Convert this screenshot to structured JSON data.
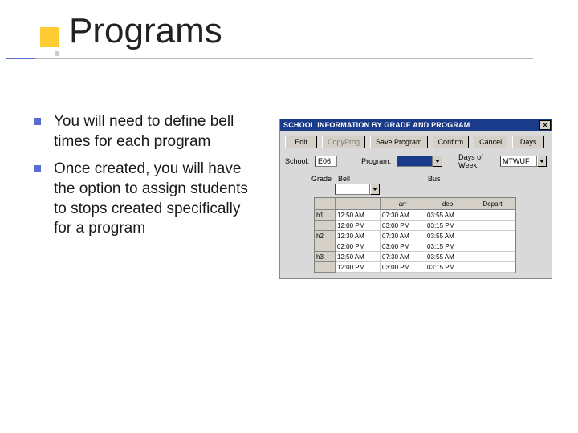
{
  "slide": {
    "title": "Programs",
    "bullets": [
      "You will need to define bell times for each program",
      "Once created, you will have the option to assign students to stops created specifically for a program"
    ]
  },
  "appwin": {
    "title": "SCHOOL INFORMATION BY GRADE AND PROGRAM",
    "close_label": "×",
    "buttons": {
      "edit": "Edit",
      "copyprog": "CopyProg",
      "saveprogram": "Save Program",
      "confirm": "Confirm",
      "cancel": "Cancel",
      "days": "Days"
    },
    "fields": {
      "school_label": "School:",
      "school_value": "E06",
      "program_label": "Program:",
      "program_value": "",
      "daysofweek_label": "Days of Week:",
      "daysofweek_value": "MTWUF"
    },
    "table": {
      "grade_label": "Grade",
      "bell_label": "Bell",
      "bus_label": "Bus",
      "col_sub": [
        "",
        "arr",
        "dep",
        "Depart"
      ],
      "rows": [
        {
          "label": "h1",
          "cells": [
            "12:50 AM",
            "07:30 AM",
            "03:55 AM",
            ""
          ]
        },
        {
          "label": "",
          "cells": [
            "12:00 PM",
            "03:00 PM",
            "03:15 PM",
            ""
          ]
        },
        {
          "label": "h2",
          "cells": [
            "12:30 AM",
            "07:30 AM",
            "03:55 AM",
            ""
          ]
        },
        {
          "label": "",
          "cells": [
            "02:00 PM",
            "03:00 PM",
            "03:15 PM",
            ""
          ]
        },
        {
          "label": "h3",
          "cells": [
            "12:50 AM",
            "07:30 AM",
            "03:55 AM",
            ""
          ]
        },
        {
          "label": "",
          "cells": [
            "12:00 PM",
            "03:00 PM",
            "03:15 PM",
            ""
          ]
        }
      ]
    }
  }
}
